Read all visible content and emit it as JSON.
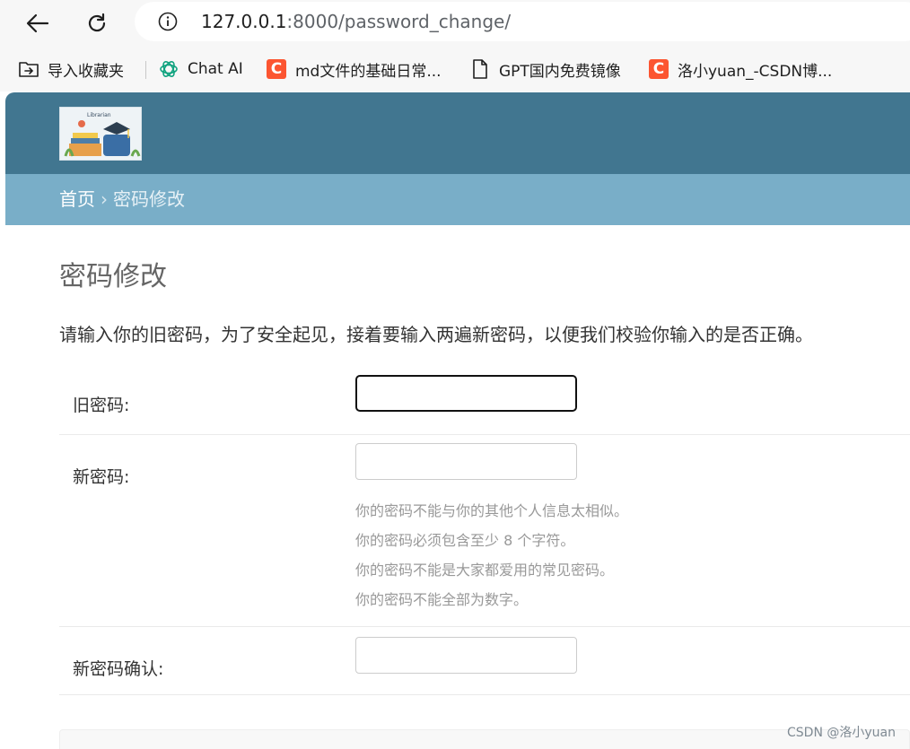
{
  "browser": {
    "url_host": "127.0.0.1",
    "url_rest": ":8000/password_change/",
    "bookmarks": [
      {
        "label": "导入收藏夹",
        "icon": "import-bookmarks-icon"
      },
      {
        "label": "Chat AI",
        "icon": "openai-icon"
      },
      {
        "label": "md文件的基础日常...",
        "icon": "csdn-icon"
      },
      {
        "label": "GPT国内免费镜像",
        "icon": "page-icon"
      },
      {
        "label": "洛小yuan_-CSDN博...",
        "icon": "csdn-icon"
      }
    ],
    "csdn_glyph": "C"
  },
  "site": {
    "logo_text": "Librarian",
    "header_color": "#417690",
    "breadcrumb_color": "#79aec8"
  },
  "breadcrumbs": {
    "home": "首页",
    "separator": "›",
    "current": "密码修改"
  },
  "page": {
    "title": "密码修改",
    "intro": "请输入你的旧密码，为了安全起见，接着要输入两遍新密码，以便我们校验你输入的是否正确。"
  },
  "form": {
    "old_password": {
      "label": "旧密码:",
      "value": ""
    },
    "new_password1": {
      "label": "新密码:",
      "value": "",
      "help": [
        "你的密码不能与你的其他个人信息太相似。",
        "你的密码必须包含至少 8 个字符。",
        "你的密码不能是大家都爱用的常见密码。",
        "你的密码不能全部为数字。"
      ]
    },
    "new_password2": {
      "label": "新密码确认:",
      "value": ""
    }
  },
  "watermark": "CSDN @洛小yuan"
}
